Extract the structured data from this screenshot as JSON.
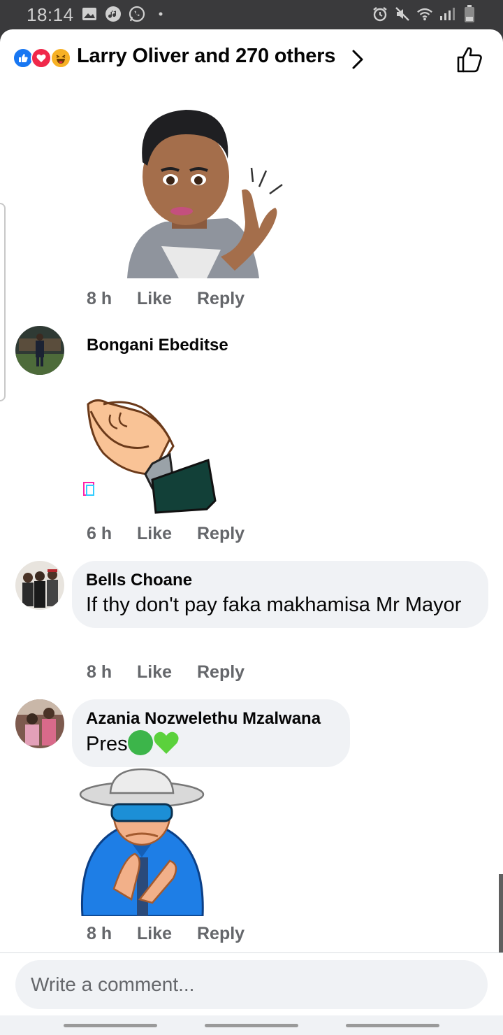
{
  "status_bar": {
    "time": "18:14",
    "left_icons": [
      "gallery-icon",
      "music-icon",
      "whatsapp-icon",
      "dot-icon"
    ],
    "right_icons": [
      "alarm-icon",
      "mute-icon",
      "wifi-icon",
      "signal-icon",
      "battery-icon"
    ]
  },
  "header": {
    "reactions": [
      "like",
      "love",
      "haha"
    ],
    "reactions_text": "Larry Oliver and 270 others",
    "like_button_icon": "thumbs-up-outline-icon"
  },
  "comments": [
    {
      "author": "",
      "text": "",
      "sticker": "avatar-clapping-sticker",
      "time": "8 h",
      "like_label": "Like",
      "reply_label": "Reply"
    },
    {
      "author": "Bongani Ebeditse",
      "text": "",
      "sticker": "clapping-hands-gif",
      "time": "6 h",
      "like_label": "Like",
      "reply_label": "Reply"
    },
    {
      "author": "Bells Choane",
      "text": "If thy don't pay faka makhamisa Mr Mayor",
      "time": "8 h",
      "like_label": "Like",
      "reply_label": "Reply"
    },
    {
      "author": "Azania Nozwelethu Mzalwana",
      "text": "Pres",
      "emojis": [
        "green-circle",
        "green-heart"
      ],
      "sticker": "man-in-hat-clapping-sticker",
      "time": "8 h",
      "like_label": "Like",
      "reply_label": "Reply"
    }
  ],
  "composer": {
    "placeholder": "Write a comment..."
  },
  "colors": {
    "like_blue": "#1877f2",
    "love_red": "#f0284a",
    "haha_yellow": "#f7b125",
    "meta_grey": "#65676b",
    "bubble_bg": "#f0f2f5",
    "status_bar_bg": "#3a3a3c"
  }
}
